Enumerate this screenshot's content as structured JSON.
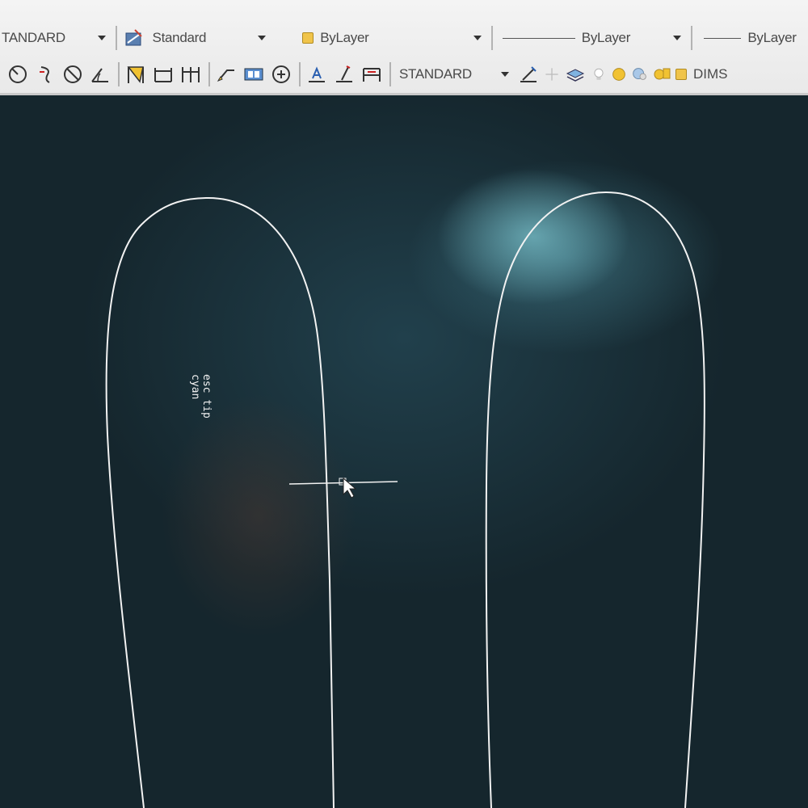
{
  "toolbar_top": {
    "text_style": "TANDARD",
    "dim_style": "Standard",
    "color": "ByLayer",
    "linetype": "ByLayer",
    "lineweight": "ByLayer"
  },
  "toolbar_bottom": {
    "icons": [
      "dim-radius-icon",
      "dim-diameter-icon",
      "dim-none-icon",
      "dim-angular-icon",
      "quick-dim-icon",
      "baseline-dim-icon",
      "continue-dim-icon",
      "leader-icon",
      "tolerance-icon",
      "center-mark-icon",
      "dim-edit-icon",
      "dim-text-edit-icon",
      "dim-update-icon"
    ],
    "dimstyle_combo": "STANDARD",
    "layer_name": "DIMS"
  },
  "drawing": {
    "annotation_line1": "esc tip",
    "annotation_line2": "cyan"
  },
  "colors": {
    "background": "#1a2a33",
    "outline": "#f2f2f2",
    "toolbar": "#eeeeee",
    "layer_swatch": "#f0c44a"
  }
}
